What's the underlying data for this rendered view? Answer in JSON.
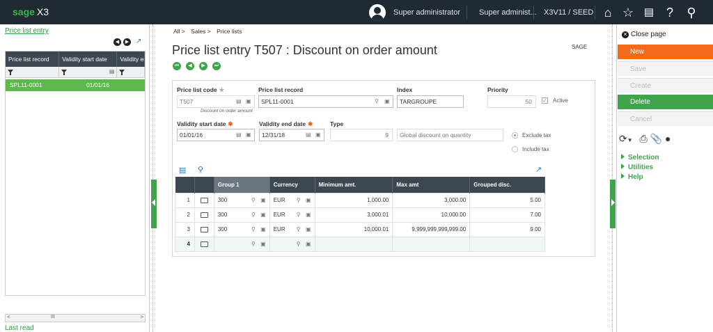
{
  "topbar": {
    "logo_brand": "sage",
    "logo_product": "X3",
    "user_name": "Super administrator",
    "role_name": "Super administ...",
    "endpoint": "X3V11 / SEED",
    "icons": [
      "home-icon",
      "star-icon",
      "news-icon",
      "help-icon",
      "search-icon"
    ]
  },
  "left": {
    "link": "Price list entry",
    "columns": [
      "Price list record",
      "Validity start date",
      "Validity er"
    ],
    "rows": [
      {
        "record": "SPL11-0001",
        "date": "01/01/16"
      }
    ],
    "scroll_label": "III",
    "last_read": "Last read"
  },
  "breadcrumb": [
    "All >",
    "Sales >",
    "Price lists"
  ],
  "title": "Price list entry T507 : Discount on order amount",
  "folder": "SAGE",
  "form": {
    "price_list_code_label": "Price list code",
    "price_list_code": "T507",
    "price_list_code_note": "Discount on order amount",
    "price_list_record_label": "Price list record",
    "price_list_record": "SPL11-0001",
    "index_label": "Index",
    "index": "TARGROUPE",
    "priority_label": "Priority",
    "priority": "50",
    "active_label": "Active",
    "validity_start_label": "Validity start date",
    "validity_start": "01/01/16",
    "validity_end_label": "Validity end date",
    "validity_end": "12/31/18",
    "type_label": "Type",
    "type_value": "9",
    "type_desc": "Global discount on quantity",
    "exclude_tax": "Exclude tax",
    "include_tax": "Include tax"
  },
  "grid": {
    "headers": [
      "",
      "",
      "Group 1",
      "Currency",
      "Minimum amt.",
      "Max amt",
      "Grouped disc."
    ],
    "rows": [
      {
        "n": "1",
        "group": "300",
        "currency": "EUR",
        "min": "1,000.00",
        "max": "3,000.00",
        "disc": "5.00"
      },
      {
        "n": "2",
        "group": "300",
        "currency": "EUR",
        "min": "3,000.01",
        "max": "10,000.00",
        "disc": "7.00"
      },
      {
        "n": "3",
        "group": "300",
        "currency": "EUR",
        "min": "10,000.01",
        "max": "9,999,999,999,999.00",
        "disc": "9.00"
      },
      {
        "n": "4",
        "group": "",
        "currency": "",
        "min": "",
        "max": "",
        "disc": ""
      }
    ]
  },
  "right": {
    "close_page": "Close page",
    "buttons": [
      "New",
      "Save",
      "Create",
      "Delete",
      "Cancel"
    ],
    "links": [
      "Selection",
      "Utilities",
      "Help"
    ]
  }
}
